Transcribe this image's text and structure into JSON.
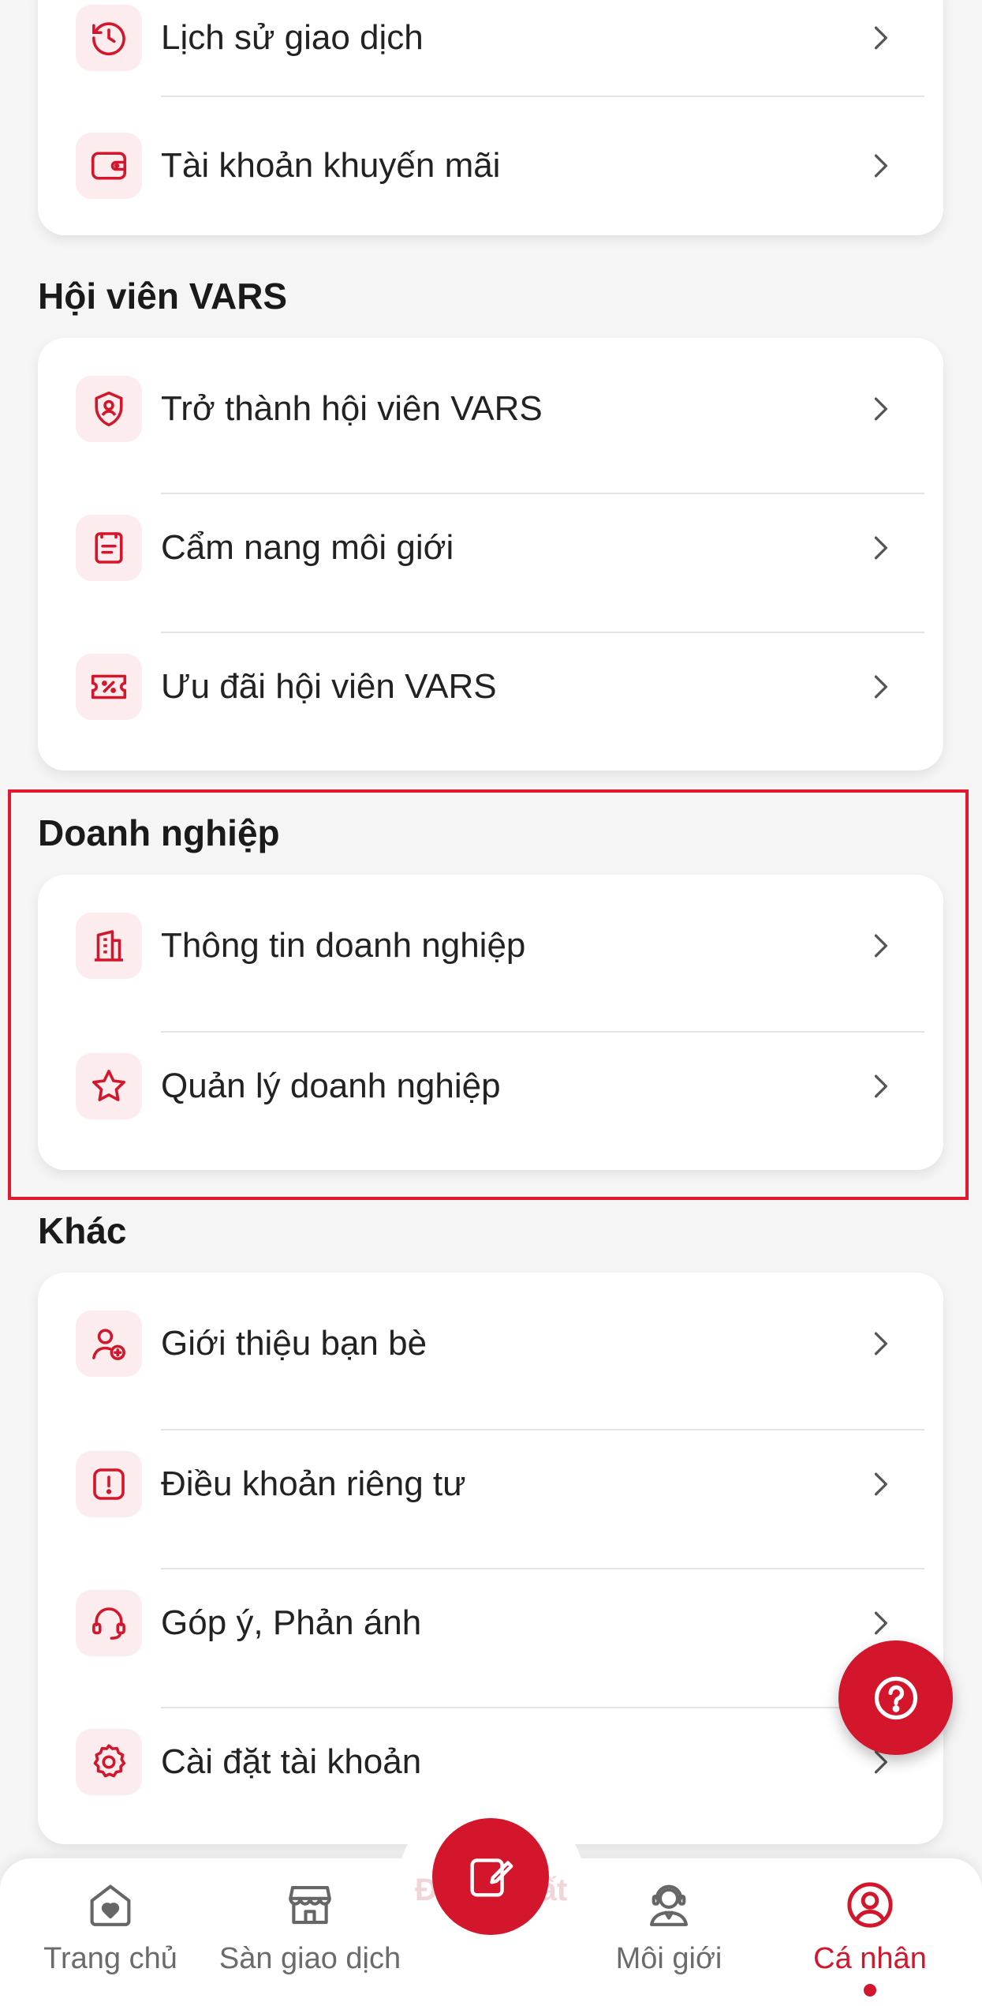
{
  "colors": {
    "accent": "#d3162b",
    "icon_bg": "#fcecee",
    "highlight": "#e0192e"
  },
  "account": {
    "items": [
      {
        "label": "Lịch sử giao dịch",
        "icon": "clock-history-icon"
      },
      {
        "label": "Tài khoản khuyến mãi",
        "icon": "wallet-icon"
      }
    ]
  },
  "membership": {
    "title": "Hội viên VARS",
    "items": [
      {
        "label": "Trở thành hội viên VARS",
        "icon": "shield-user-icon"
      },
      {
        "label": "Cẩm nang môi giới",
        "icon": "handbook-icon"
      },
      {
        "label": "Ưu đãi hội viên VARS",
        "icon": "ticket-discount-icon"
      }
    ]
  },
  "business": {
    "title": "Doanh nghiệp",
    "items": [
      {
        "label": "Thông tin doanh nghiệp",
        "icon": "building-icon"
      },
      {
        "label": "Quản lý doanh nghiệp",
        "icon": "star-icon"
      }
    ]
  },
  "other": {
    "title": "Khác",
    "items": [
      {
        "label": "Giới thiệu bạn bè",
        "icon": "user-add-icon"
      },
      {
        "label": "Điều khoản riêng tư",
        "icon": "alert-icon"
      },
      {
        "label": "Góp ý, Phản ánh",
        "icon": "headset-icon"
      },
      {
        "label": "Cài đặt tài khoản",
        "icon": "gear-icon"
      }
    ]
  },
  "logout_label": "Đăng xuất",
  "bottom_nav": {
    "items": [
      {
        "label": "Trang chủ",
        "icon": "home-heart-icon"
      },
      {
        "label": "Sàn giao dịch",
        "icon": "store-icon"
      },
      {
        "label": "Môi giới",
        "icon": "broker-icon"
      },
      {
        "label": "Cá nhân",
        "icon": "profile-icon",
        "active": true
      }
    ],
    "center_action_icon": "edit-note-icon"
  },
  "help_icon": "help-question-icon"
}
